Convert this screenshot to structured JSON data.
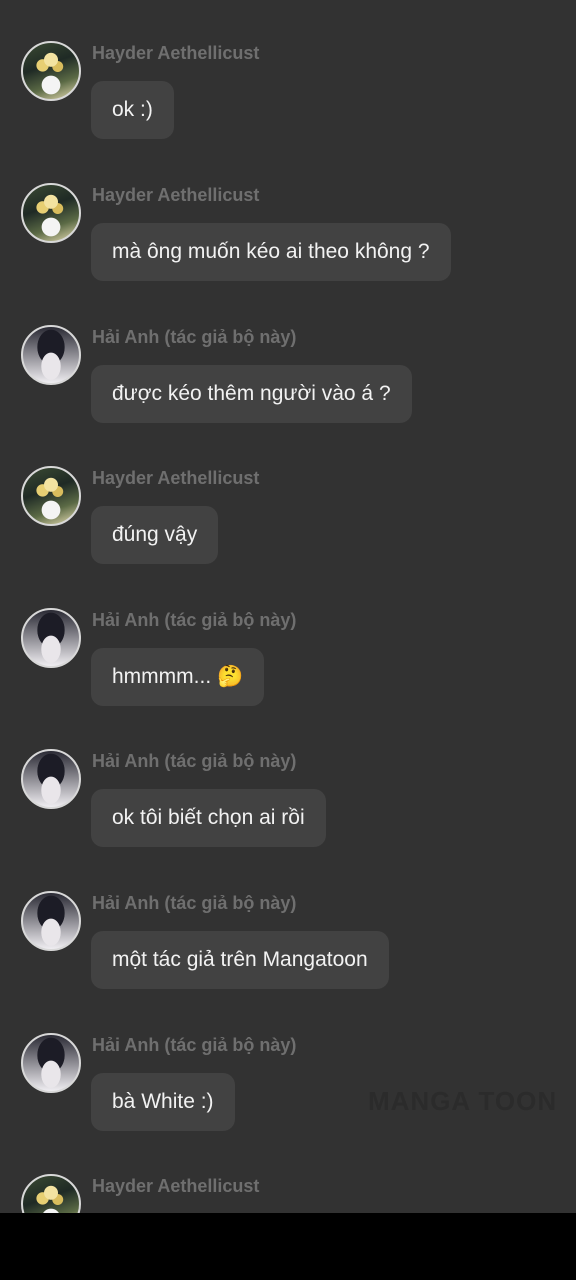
{
  "messages": [
    {
      "sender": "Hayder Aethellicust",
      "avatar": "avatar-blonde-character",
      "text": "ok :)"
    },
    {
      "sender": "Hayder Aethellicust",
      "avatar": "avatar-blonde-character",
      "text": "mà ông muốn kéo ai theo không ?"
    },
    {
      "sender": "Hải Anh (tác giả bộ này)",
      "avatar": "avatar-dark-hair-character",
      "text": "được kéo thêm người vào á ?"
    },
    {
      "sender": "Hayder Aethellicust",
      "avatar": "avatar-blonde-character",
      "text": "đúng vậy"
    },
    {
      "sender": "Hải Anh (tác giả bộ này)",
      "avatar": "avatar-dark-hair-character",
      "text": "hmmmm... 🤔"
    },
    {
      "sender": "Hải Anh (tác giả bộ này)",
      "avatar": "avatar-dark-hair-character",
      "text": "ok tôi biết chọn ai rồi"
    },
    {
      "sender": "Hải Anh (tác giả bộ này)",
      "avatar": "avatar-dark-hair-character",
      "text": "một tác giả trên Mangatoon"
    },
    {
      "sender": "Hải Anh (tác giả bộ này)",
      "avatar": "avatar-dark-hair-character",
      "text": "bà White  :)"
    },
    {
      "sender": "Hayder Aethellicust",
      "avatar": "avatar-blonde-character",
      "text": ""
    }
  ],
  "watermark": "MANGA TOON",
  "colors": {
    "background": "#323232",
    "bubble": "#424242",
    "bubble_text": "#f2f2f2",
    "sender_name": "#6f6f6f"
  }
}
